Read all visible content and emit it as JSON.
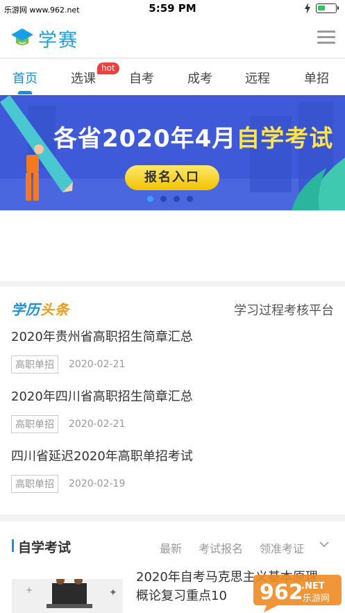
{
  "status_bar": {
    "left_text": "乐游网 www.962.net",
    "time": "5:59 PM",
    "battery_level": 0.45
  },
  "header": {
    "logo_text": "学赛",
    "brand_color": "#1a9ee6"
  },
  "tabs": [
    {
      "label": "首页",
      "active": true
    },
    {
      "label": "选课",
      "badge": "hot"
    },
    {
      "label": "自考"
    },
    {
      "label": "成考"
    },
    {
      "label": "远程"
    },
    {
      "label": "单招"
    }
  ],
  "banner": {
    "title_main": "各省2020年4月",
    "title_highlight": "自学考试",
    "button_label": "报名入口",
    "slide_count": 4,
    "active_slide": 1
  },
  "news": {
    "logo_left": "学历",
    "logo_right": "头条",
    "right_link": "学习过程考核平台",
    "items": [
      {
        "title": "2020年贵州省高职招生简章汇总",
        "tag": "高职单招",
        "date": "2020-02-21"
      },
      {
        "title": "2020年四川省高职招生简章汇总",
        "tag": "高职单招",
        "date": "2020-02-21"
      },
      {
        "title": "四川省延迟2020年高职单招考试",
        "tag": "高职单招",
        "date": "2020-02-19"
      }
    ]
  },
  "study": {
    "title": "自学考试",
    "links": [
      "最新",
      "考试报名",
      "领准考证"
    ],
    "article_title": "2020年自考马克思主义基本原理概论复习重点10"
  },
  "watermark": {
    "text": "962",
    "sub": "乐游网",
    "net": ".NET"
  }
}
